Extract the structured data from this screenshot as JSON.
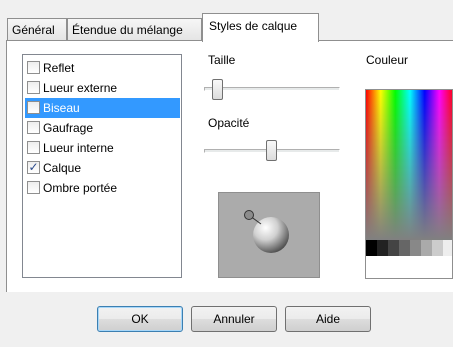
{
  "tabs": [
    {
      "label": "Général"
    },
    {
      "label": "Étendue du mélange"
    },
    {
      "label": "Styles de calque",
      "active": true
    }
  ],
  "styles_list": {
    "items": [
      {
        "label": "Reflet",
        "checked": false,
        "selected": false
      },
      {
        "label": "Lueur externe",
        "checked": false,
        "selected": false
      },
      {
        "label": "Biseau",
        "checked": false,
        "selected": true
      },
      {
        "label": "Gaufrage",
        "checked": false,
        "selected": false
      },
      {
        "label": "Lueur interne",
        "checked": false,
        "selected": false
      },
      {
        "label": "Calque",
        "checked": true,
        "selected": false
      },
      {
        "label": "Ombre portée",
        "checked": false,
        "selected": false
      }
    ]
  },
  "size": {
    "label": "Taille",
    "value_fraction": 0.05
  },
  "opacity": {
    "label": "Opacité",
    "value_fraction": 0.5
  },
  "color": {
    "label": "Couleur",
    "accent": "#3399ff"
  },
  "buttons": {
    "ok": "OK",
    "cancel": "Annuler",
    "help": "Aide"
  }
}
